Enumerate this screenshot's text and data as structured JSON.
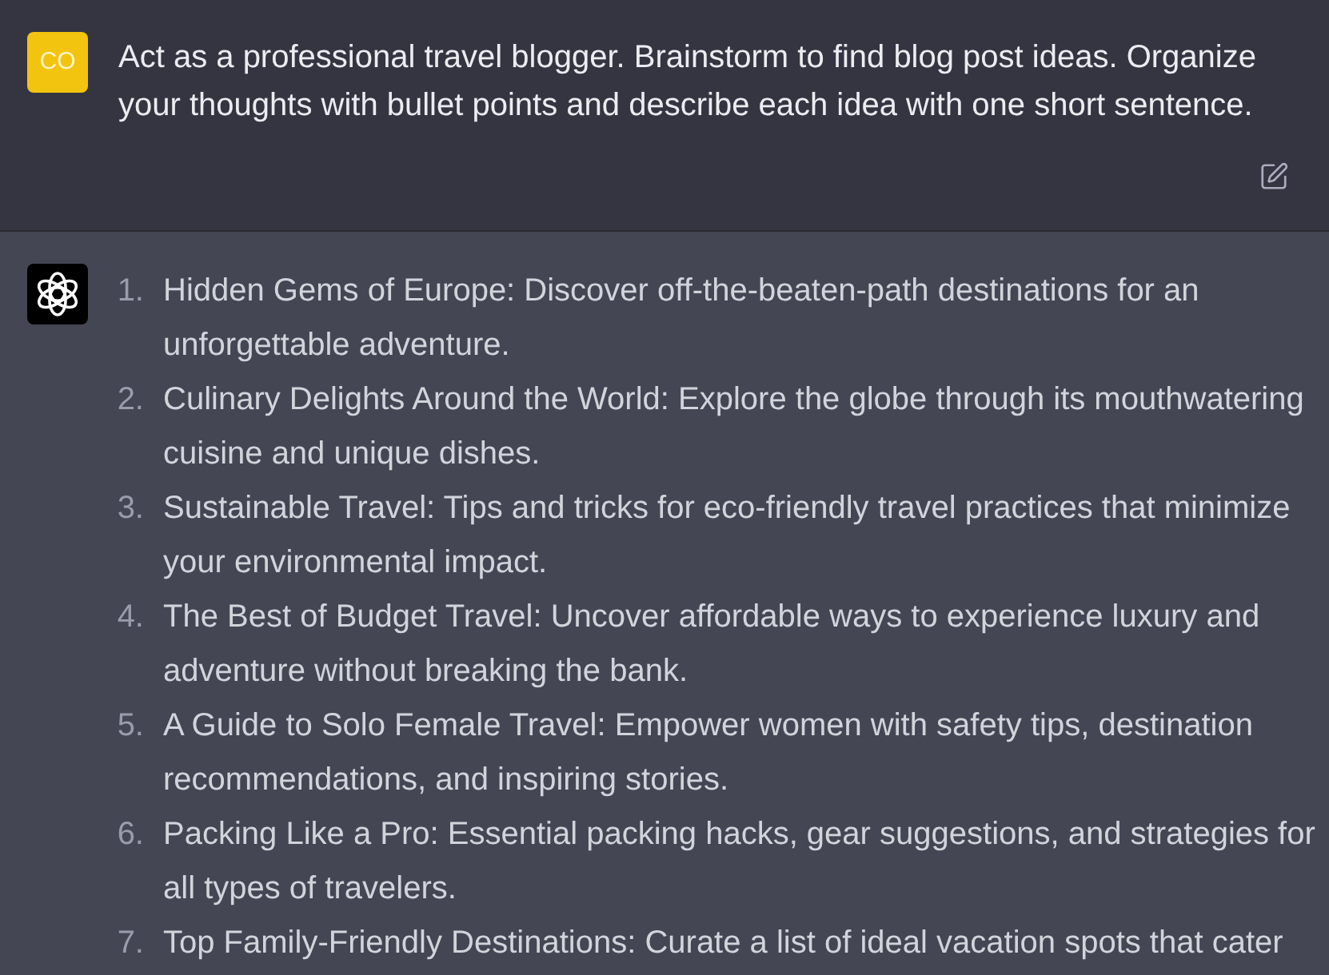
{
  "user_message": {
    "avatar_initials": "CO",
    "text": "Act as a professional travel blogger. Brainstorm to find blog post ideas. Organize your thoughts with bullet points and describe each idea with one short sentence."
  },
  "assistant_message": {
    "items": [
      {
        "number": "1.",
        "text": "Hidden Gems of Europe: Discover off-the-beaten-path destinations for an unforgettable adventure."
      },
      {
        "number": "2.",
        "text": "Culinary Delights Around the World: Explore the globe through its mouthwatering cuisine and unique dishes."
      },
      {
        "number": "3.",
        "text": "Sustainable Travel: Tips and tricks for eco-friendly travel practices that minimize your environmental impact."
      },
      {
        "number": "4.",
        "text": "The Best of Budget Travel: Uncover affordable ways to experience luxury and adventure without breaking the bank."
      },
      {
        "number": "5.",
        "text": "A Guide to Solo Female Travel: Empower women with safety tips, destination recommendations, and inspiring stories."
      },
      {
        "number": "6.",
        "text": "Packing Like a Pro: Essential packing hacks, gear suggestions, and strategies for all types of travelers."
      },
      {
        "number": "7.",
        "text": "Top Family-Friendly Destinations: Curate a list of ideal vacation spots that cater"
      }
    ]
  }
}
